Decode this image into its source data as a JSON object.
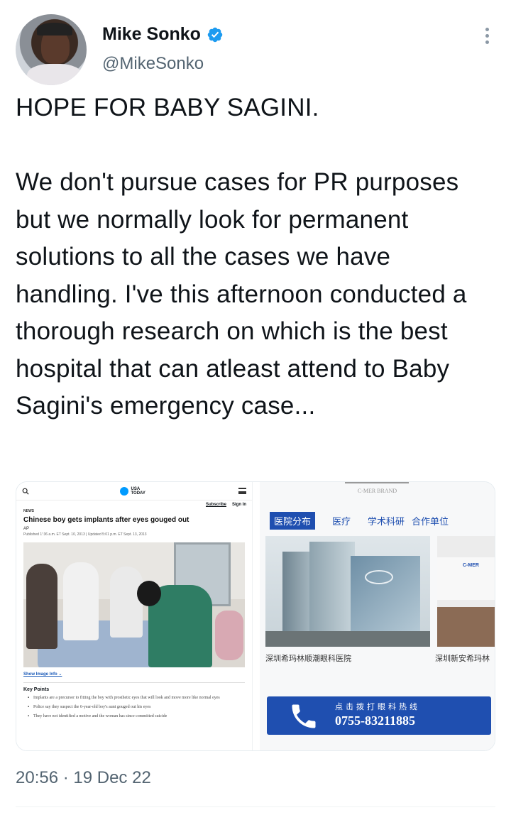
{
  "author": {
    "name": "Mike Sonko",
    "handle": "@MikeSonko",
    "verified_icon": "verified-badge-icon",
    "accent_color": "#1d9bf0"
  },
  "tweet": {
    "text": "HOPE FOR BABY SAGINI.\n\nWe don't pursue cases for PR purposes but we normally look for permanent solutions to all the cases we have handling. I've this afternoon conducted a thorough research on which is the best hospital that can atleast attend to Baby Sagini's emergency case...",
    "timestamp": "20:56 · 19 Dec 22"
  },
  "media_left": {
    "site_logo": "USA TODAY",
    "subscribe": "Subscribe",
    "sign_in": "Sign In",
    "section": "NEWS",
    "headline": "Chinese boy gets implants after eyes gouged out",
    "byline": "AP",
    "published": "Published 1':36 a.m. ET Sept. 10, 2013 | Updated 5:01 p.m. ET Sept. 13, 2013",
    "show_info": "Show Image Info ⌄",
    "key_points_title": "Key Points",
    "key_points": [
      "Implants are a precursor to fitting the boy with prosthetic eyes that will look and move more like normal eyes",
      "Police say they suspect the 6-year-old boy's aunt gouged out his eyes",
      "They have not identified a motive and the woman has since committed suicide"
    ]
  },
  "media_right": {
    "brand": "C-MER BRAND",
    "nav": [
      "医院分布",
      "医疗",
      "学术科研",
      "合作单位"
    ],
    "caption_1": "深圳希玛林顺潮眼科医院",
    "caption_2": "深圳新安希玛林",
    "interior_logo": "C-MER",
    "hotline_label": "点击拨打眼科热线",
    "hotline_number": "0755-83211885",
    "hotline_color": "#1f4fb0"
  }
}
